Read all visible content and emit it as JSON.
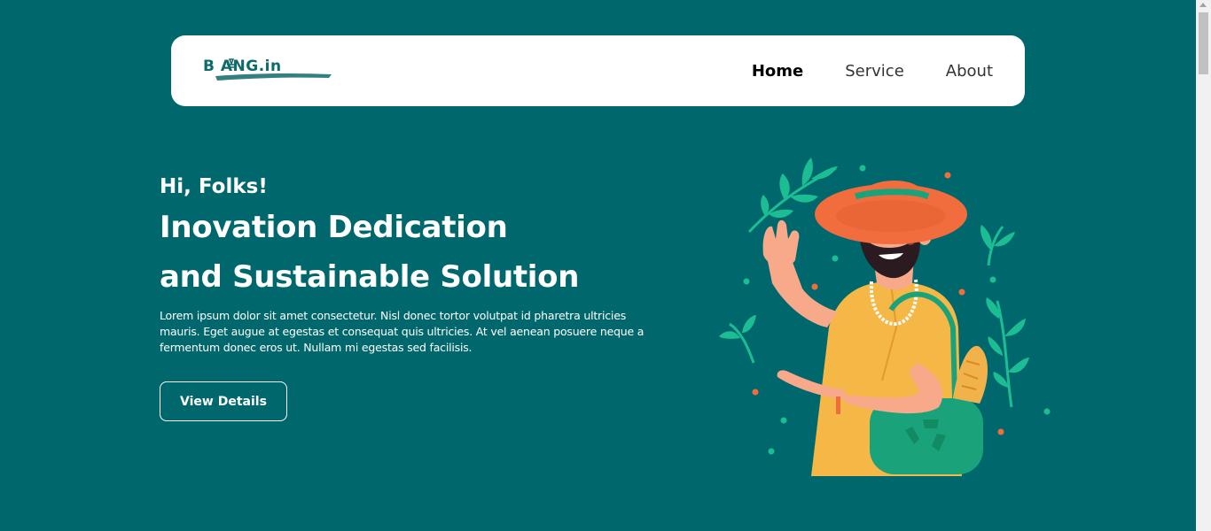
{
  "brand": {
    "logo_text": "B  ANG.in"
  },
  "nav": {
    "items": [
      {
        "label": "Home",
        "active": true
      },
      {
        "label": "Service",
        "active": false
      },
      {
        "label": "About",
        "active": false
      }
    ]
  },
  "hero": {
    "greeting": "Hi, Folks!",
    "headline_line1": "Inovation Dedication",
    "headline_line2": "and Sustainable Solution",
    "description": "Lorem ipsum dolor sit amet consectetur. Nisl donec tortor volutpat id pharetra ultricies mauris. Eget augue at egestas et consequat quis ultricies. At vel aenean posuere neque a fermentum donec eros ut. Nullam mi egestas sed facilisis.",
    "button_label": "View Details"
  },
  "colors": {
    "background": "#00686c",
    "navbar": "#ffffff",
    "accent_orange": "#f26d3d",
    "leaf_green": "#1dbd94",
    "shirt_yellow": "#f5b847"
  },
  "icons": [
    "recycle-icon",
    "leaf-icon"
  ]
}
